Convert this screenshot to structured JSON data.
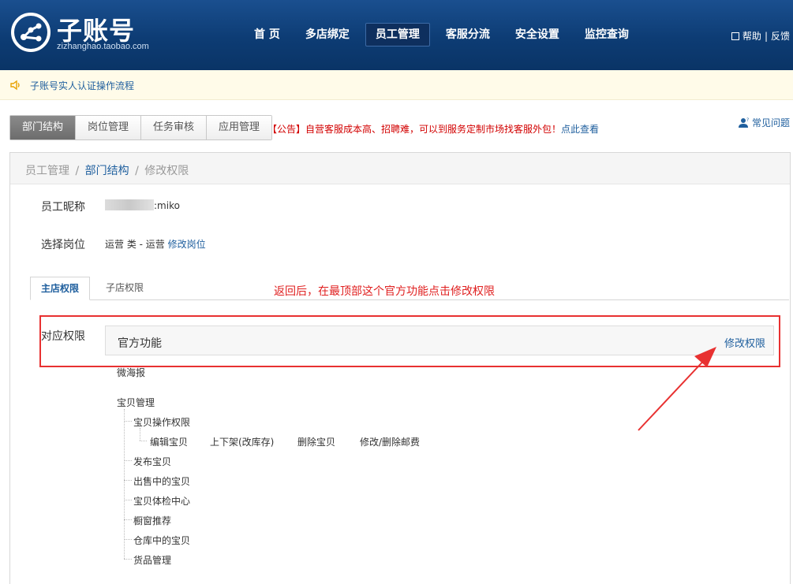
{
  "header": {
    "logo_title": "子账号",
    "logo_subtitle": "zizhanghao.taobao.com",
    "nav": [
      {
        "label": "首 页",
        "active": false
      },
      {
        "label": "多店绑定",
        "active": false
      },
      {
        "label": "员工管理",
        "active": true
      },
      {
        "label": "客服分流",
        "active": false
      },
      {
        "label": "安全设置",
        "active": false
      },
      {
        "label": "监控查询",
        "active": false
      }
    ],
    "help_label": "帮助",
    "help_separator": "|",
    "feedback_label": "反馈"
  },
  "notice": {
    "text": "子账号实人认证操作流程"
  },
  "tabs": [
    {
      "label": "部门结构",
      "active": true
    },
    {
      "label": "岗位管理",
      "active": false
    },
    {
      "label": "任务审核",
      "active": false
    },
    {
      "label": "应用管理",
      "active": false
    }
  ],
  "announcement": {
    "text": "【公告】自营客服成本高、招聘难，可以到服务定制市场找客服外包！",
    "link": "点此查看"
  },
  "faq_label": "常见问题",
  "breadcrumb": {
    "root": "员工管理",
    "sep1": "/",
    "current_parent": "部门结构",
    "sep2": "/",
    "current": "修改权限"
  },
  "employee": {
    "nickname_label": "员工昵称",
    "nickname_value_suffix": ":miko",
    "position_label": "选择岗位",
    "position_value": "运营 类 - 运营",
    "edit_position_link": "修改岗位"
  },
  "subtabs": {
    "main_shop": "主店权限",
    "sub_shop": "子店权限"
  },
  "annotation": "返回后，在最顶部这个官方功能点击修改权限",
  "permissions": {
    "label": "对应权限",
    "group_title": "官方功能",
    "edit_link": "修改权限",
    "items": {
      "weihaibao": "微海报",
      "baobei_manage": "宝贝管理",
      "baobei_ops": "宝贝操作权限",
      "edit_item": "编辑宝贝",
      "shelve": "上下架(改库存)",
      "delete_item": "删除宝贝",
      "edit_postage": "修改/删除邮费",
      "publish_item": "发布宝贝",
      "on_sale": "出售中的宝贝",
      "check_center": "宝贝体检中心",
      "window_recommend": "橱窗推荐",
      "warehouse": "仓库中的宝贝",
      "goods_manage": "货品管理"
    }
  },
  "colors": {
    "header_bg": "#0d3c74",
    "link_blue": "#1f5f9e",
    "annotation_red": "#e83131"
  }
}
